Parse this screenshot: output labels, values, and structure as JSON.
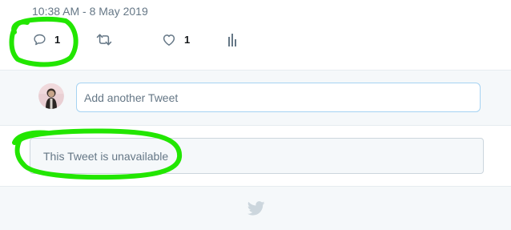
{
  "tweet": {
    "timestamp": "10:38 AM - 8 May 2019",
    "reply_count": "1",
    "like_count": "1"
  },
  "reply_bar": {
    "placeholder": "Add another Tweet"
  },
  "unavailable": {
    "text": "This Tweet is unavailable"
  },
  "colors": {
    "secondary_text": "#657786",
    "page_bg": "#f5f8fa",
    "input_border": "#a6d3f2",
    "annotation": "#22e600",
    "brand_icon": "#ccd6dd"
  },
  "icons": [
    "reply-icon",
    "retweet-icon",
    "like-icon",
    "analytics-icon",
    "twitter-bird-icon"
  ]
}
